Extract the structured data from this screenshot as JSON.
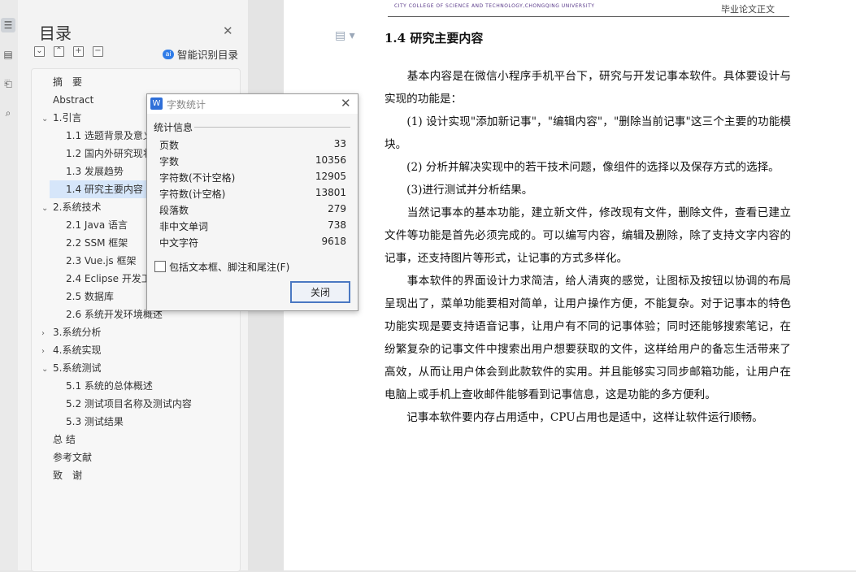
{
  "toc": {
    "title": "目录",
    "smart_label": "智能识别目录",
    "smart_icon_text": "ai",
    "tools": [
      "⌄",
      "⌃",
      "+",
      "−"
    ],
    "items": [
      {
        "label": "摘　要",
        "level": 1,
        "arrow": ""
      },
      {
        "label": "Abstract",
        "level": 1,
        "arrow": ""
      },
      {
        "label": "1.引言",
        "level": 1,
        "arrow": "⌄"
      },
      {
        "label": "1.1 选题背景及意义",
        "level": 2,
        "arrow": ""
      },
      {
        "label": "1.2 国内外研究现状",
        "level": 2,
        "arrow": ""
      },
      {
        "label": "1.3 发展趋势",
        "level": 2,
        "arrow": ""
      },
      {
        "label": "1.4 研究主要内容",
        "level": 2,
        "arrow": "",
        "selected": true
      },
      {
        "label": "2.系统技术",
        "level": 1,
        "arrow": "⌄"
      },
      {
        "label": "2.1 Java 语言",
        "level": 2,
        "arrow": ""
      },
      {
        "label": "2.2 SSM 框架",
        "level": 2,
        "arrow": ""
      },
      {
        "label": "2.3 Vue.js 框架",
        "level": 2,
        "arrow": ""
      },
      {
        "label": "2.4 Eclipse 开发工具",
        "level": 2,
        "arrow": ""
      },
      {
        "label": "2.5 数据库",
        "level": 2,
        "arrow": ""
      },
      {
        "label": "2.6 系统开发环境概述",
        "level": 2,
        "arrow": ""
      },
      {
        "label": "3.系统分析",
        "level": 1,
        "arrow": "›"
      },
      {
        "label": "4.系统实现",
        "level": 1,
        "arrow": "›"
      },
      {
        "label": "5.系统测试",
        "level": 1,
        "arrow": "⌄"
      },
      {
        "label": "5.1 系统的总体概述",
        "level": 2,
        "arrow": ""
      },
      {
        "label": "5.2 测试项目名称及测试内容",
        "level": 2,
        "arrow": ""
      },
      {
        "label": "5.3 测试结果",
        "level": 2,
        "arrow": ""
      },
      {
        "label": "总 结",
        "level": 1,
        "arrow": ""
      },
      {
        "label": "参考文献",
        "level": 1,
        "arrow": ""
      },
      {
        "label": "致　谢",
        "level": 1,
        "arrow": ""
      }
    ]
  },
  "dialog": {
    "logo": "W",
    "title": "字数统计",
    "section": "统计信息",
    "rows": [
      {
        "key": "页数",
        "value": "33"
      },
      {
        "key": "字数",
        "value": "10356"
      },
      {
        "key": "字符数(不计空格)",
        "value": "12905"
      },
      {
        "key": "字符数(计空格)",
        "value": "13801"
      },
      {
        "key": "段落数",
        "value": "279"
      },
      {
        "key": "非中文单词",
        "value": "738"
      },
      {
        "key": "中文字符",
        "value": "9618"
      }
    ],
    "checkbox_label": "包括文本框、脚注和尾注(F)",
    "close_label": "关闭"
  },
  "document": {
    "header_school": "CITY COLLEGE OF SCIENCE AND TECHNOLOGY,CHONGQING UNIVERSITY",
    "header_right": "毕业论文正文",
    "heading": "1.4  研究主要内容",
    "paragraphs": [
      "　　基本内容是在微信小程序手机平台下，研究与开发记事本软件。具体要设计与实现的功能是：",
      "　　(1) 设计实现\"添加新记事\"，\"编辑内容\"，\"删除当前记事\"这三个主要的功能模块。",
      "　　(2) 分析并解决实现中的若干技术问题，像组件的选择以及保存方式的选择。",
      "　　(3)进行测试并分析结果。",
      "　　当然记事本的基本功能，建立新文件，修改现有文件，删除文件，查看已建立文件等功能是首先必须完成的。可以编写内容，编辑及删除，除了支持文字内容的记事，还支持图片等形式，让记事的方式多样化。",
      "　　事本软件的界面设计力求简洁，给人清爽的感觉，让图标及按钮以协调的布局呈现出了，菜单功能要相对简单，让用户操作方便，不能复杂。对于记事本的特色功能实现是要支持语音记事，让用户有不同的记事体验；同时还能够搜索笔记，在纷繁复杂的记事文件中搜索出用户想要获取的文件，这样给用户的备忘生活带来了高效，从而让用户体会到此款软件的实用。并且能够实习同步邮箱功能，让用户在电脑上或手机上查收邮件能够看到记事信息，这是功能的多方便利。",
      "　　记事本软件要内存占用适中，CPU占用也是适中，这样让软件运行顺畅。"
    ]
  }
}
